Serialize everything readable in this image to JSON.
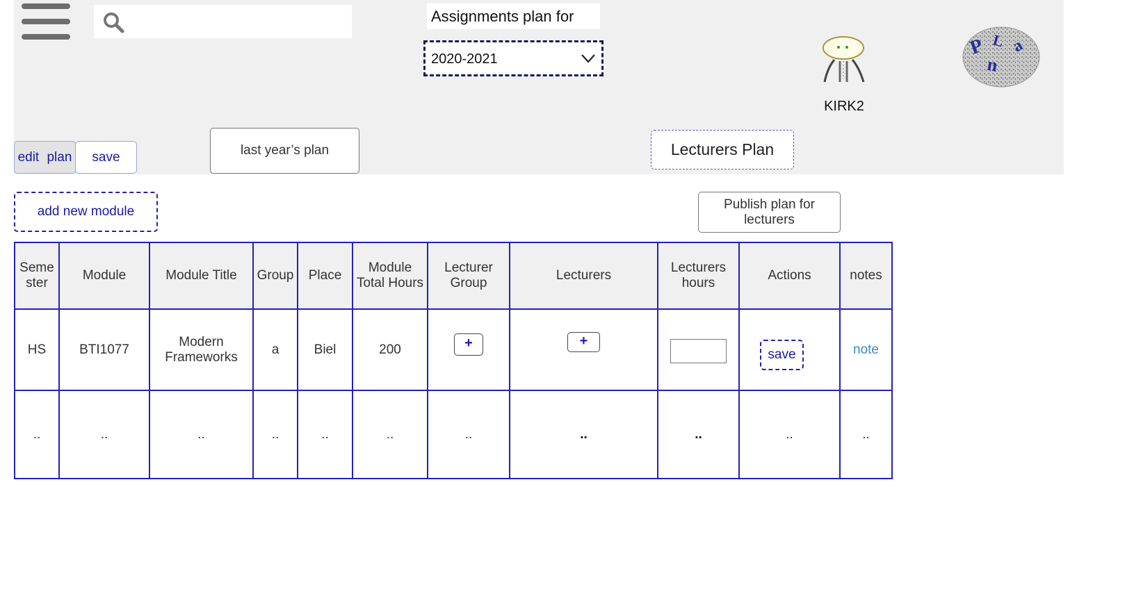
{
  "header": {
    "search": {
      "value": "",
      "placeholder": ""
    },
    "plan_title": "Assignments plan for",
    "year_select": {
      "value": "2020-2021"
    },
    "user": {
      "name": "KIRK2"
    },
    "logo_text": "Plan"
  },
  "toolbar": {
    "edit_plan_label": "edit  plan",
    "save_label": "save",
    "last_year_label": "last year’s plan",
    "lecturers_plan_label": "Lecturers Plan",
    "add_module_label": "add new module",
    "publish_label": "Publish plan for lecturers"
  },
  "table": {
    "headers": [
      "Seme ster",
      "Module",
      "Module Title",
      "Group",
      "Place",
      "Module Total Hours",
      "Lecturer Group",
      "Lecturers",
      "Lecturers hours",
      "Actions",
      "notes"
    ],
    "rows": [
      {
        "semester": "HS",
        "module": "BTI1077",
        "title": "Modern Frameworks",
        "group": "a",
        "place": "Biel",
        "total_hours": "200",
        "lecturer_group_btn": "+",
        "lecturers_btn": "+",
        "lecturers_hours": "",
        "action_save": "save",
        "note": "note"
      },
      {
        "cells": [
          "..",
          "..",
          "..",
          "..",
          "..",
          "..",
          "..",
          "..",
          "..",
          "..",
          ".."
        ]
      }
    ]
  },
  "colors": {
    "header_bg": "#f0f0f0",
    "table_border": "#2222bb",
    "link_blue": "#1a1aa8",
    "note_blue": "#3a8ac8"
  },
  "icons": [
    "hamburger-menu-icon",
    "search-icon",
    "chevron-down-icon",
    "user-avatar-icon",
    "logo-icon"
  ]
}
